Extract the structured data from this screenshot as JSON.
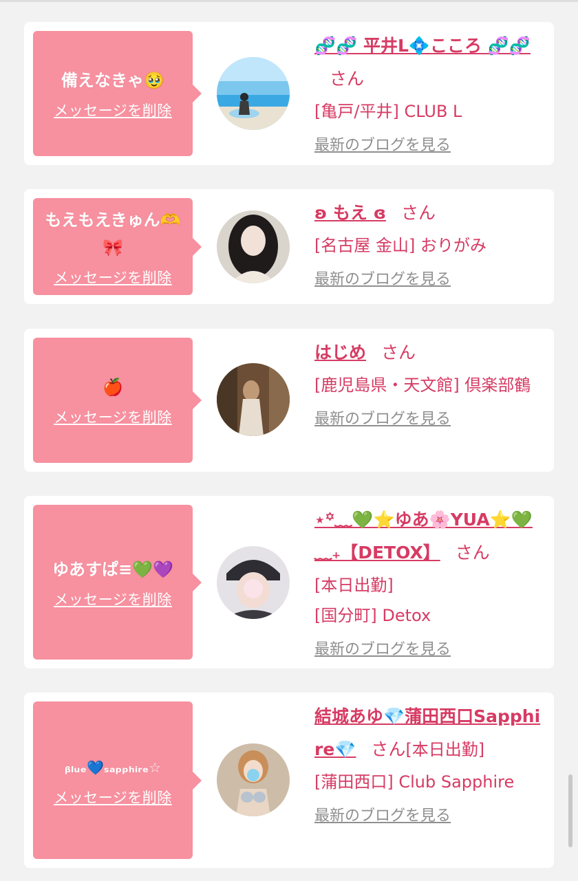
{
  "colors": {
    "bubble": "#f7909f",
    "accent": "#d63b63",
    "link_gray": "#8f8f8f",
    "page_bg": "#f2f2f2"
  },
  "cards": [
    {
      "message": "備えなきゃ🥹",
      "delete_label": "メッセージを削除",
      "name": "🧬🧬 平井L💠こころ 🧬🧬",
      "honorific": "さん",
      "shop": "[亀戸/平井] CLUB L",
      "blog_label": "最新のブログを見る"
    },
    {
      "message": "もえもえきゅん🫶🎀",
      "delete_label": "メッセージを削除",
      "name": "ʚ もえ ɞ",
      "honorific": "さん",
      "shop": "[名古屋 金山] おりがみ",
      "blog_label": "最新のブログを見る"
    },
    {
      "message": "🍎",
      "delete_label": "メッセージを削除",
      "name": "はじめ",
      "honorific": "さん",
      "shop": "[鹿児島県・天文館] 倶楽部鶴",
      "blog_label": "最新のブログを見る"
    },
    {
      "message": "ゆあすぱ≡💚💜",
      "delete_label": "メッセージを削除",
      "name": "⋆꙳﹏💚⭐ゆあ🌸YUA⭐💚﹏₊【DETOX】",
      "honorific": "さん",
      "status": "[本日出勤]",
      "shop": "[国分町] Detox",
      "blog_label": "最新のブログを見る"
    },
    {
      "message": "ᵦₗᵤₑ💙ₛₐₚₚₕᵢᵣₑ☆",
      "delete_label": "メッセージを削除",
      "name": "結城あゆ💎蒲田西口Sapphire💎",
      "honorific": "さん",
      "status": "[本日出勤]",
      "shop": "[蒲田西口] Club Sapphire",
      "blog_label": "最新のブログを見る"
    }
  ]
}
